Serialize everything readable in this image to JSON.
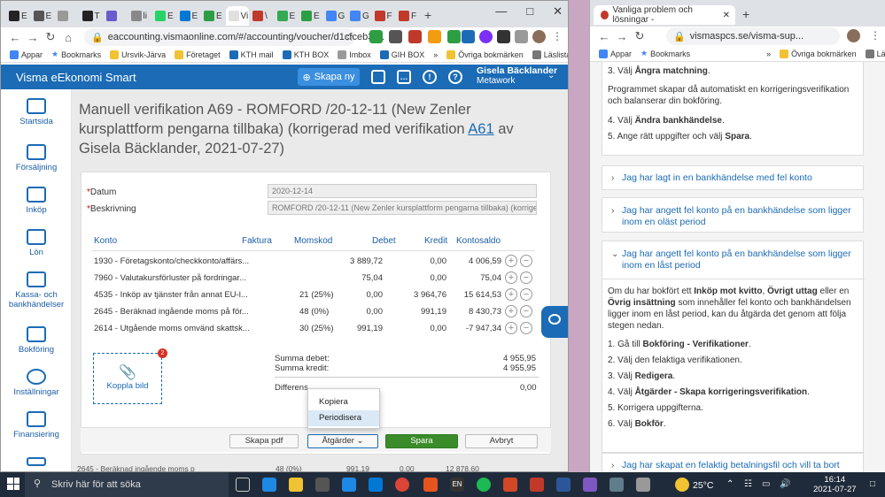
{
  "browser_left": {
    "tabs": [
      {
        "label": "E",
        "color": "#222"
      },
      {
        "label": "E",
        "color": "#555"
      },
      {
        "label": "",
        "color": "#999"
      },
      {
        "label": "T",
        "color": "#222"
      },
      {
        "label": "",
        "color": "#6a5acd"
      },
      {
        "label": "li",
        "color": "#888"
      },
      {
        "label": "E",
        "color": "#25d366"
      },
      {
        "label": "E",
        "color": "#0078d4"
      },
      {
        "label": "E",
        "color": "#2e9e44"
      },
      {
        "label": "Vi",
        "color": "#e0e0e0"
      },
      {
        "label": "\\",
        "color": "#c0392b"
      },
      {
        "label": "E",
        "color": "#34a853"
      },
      {
        "label": "E",
        "color": "#2e9e44"
      },
      {
        "label": "G",
        "color": "#4285f4"
      },
      {
        "label": "G",
        "color": "#4285f4"
      },
      {
        "label": "F",
        "color": "#c0392b"
      },
      {
        "label": "F",
        "color": "#c0392b"
      }
    ],
    "new_tab": "+",
    "url": "eaccounting.vismaonline.com/#/accounting/voucher/d1cfceb3-...",
    "bookmarks": [
      "Appar",
      "Bookmarks",
      "Ursvik-Järva",
      "Företaget",
      "KTH mail",
      "KTH BOX",
      "Imbox",
      "GIH BOX"
    ],
    "bookmarks_more": "»",
    "other_bookmarks": "Övriga bokmärken",
    "reading_list": "Läslista"
  },
  "app": {
    "name": "Visma eEkonomi Smart",
    "create_button": "Skapa ny",
    "user_name": "Gisela Bäcklander",
    "company": "Metawork",
    "sidebar": [
      "Startsida",
      "Försäljning",
      "Inköp",
      "Lön",
      "Kassa- och bankhändelser",
      "Bokföring",
      "Inställningar",
      "Finansiering"
    ]
  },
  "voucher": {
    "title_prefix": "Manuell verifikation A69  -  ROMFORD /20-12-11 (New Zenler kursplattform pengarna tillbaka) (korrigerad med verifikation ",
    "title_link": "A61",
    "title_suffix": " av Gisela Bäcklander, 2021-07-27)",
    "date_label": "Datum",
    "date_value": "2020-12-14",
    "description_label": "Beskrivning",
    "description_value": "ROMFORD /20-12-11 (New Zenler kursplattform pengarna tillbaka) (korriger",
    "columns": [
      "Konto",
      "Faktura",
      "Momskod",
      "Debet",
      "Kredit",
      "Kontosaldo"
    ],
    "rows": [
      {
        "konto": "1930 - Företagskonto/checkkonto/affärs...",
        "momskod": "",
        "debet": "3 889,72",
        "kredit": "0,00",
        "saldo": "4 006,59"
      },
      {
        "konto": "7960 - Valutakursförluster på fordringar...",
        "momskod": "",
        "debet": "75,04",
        "kredit": "0,00",
        "saldo": "75,04"
      },
      {
        "konto": "4535 - Inköp av tjänster från annat EU-l...",
        "momskod": "21 (25%)",
        "debet": "0,00",
        "kredit": "3 964,76",
        "saldo": "15 614,53"
      },
      {
        "konto": "2645 - Beräknad ingående moms på för...",
        "momskod": "48 (0%)",
        "debet": "0,00",
        "kredit": "991,19",
        "saldo": "8 430,73"
      },
      {
        "konto": "2614 - Utgående moms omvänd skattsk...",
        "momskod": "30 (25%)",
        "debet": "991,19",
        "kredit": "0,00",
        "saldo": "-7 947,34"
      }
    ],
    "attach_label": "Koppla bild",
    "attach_count": "2",
    "sum_debet_label": "Summa debet:",
    "sum_debet": "4 955,95",
    "sum_kredit_label": "Summa kredit:",
    "sum_kredit": "4 955,95",
    "diff_label": "Differens",
    "diff_value": "0,00",
    "dropdown": [
      "Kopiera",
      "Periodisera"
    ],
    "btn_pdf": "Skapa pdf",
    "btn_actions": "Åtgärder",
    "btn_save": "Spara",
    "btn_cancel": "Avbryt",
    "peek_row": {
      "konto": "2645 - Beräknad ingående moms p",
      "momskod": "48 (0%)",
      "debet": "991,19",
      "kredit": "0,00",
      "saldo": "12 878,60"
    }
  },
  "browser_right": {
    "tab_title": "Vanliga problem och lösningar -",
    "url": "vismaspcs.se/visma-sup...",
    "bookmarks": [
      "Appar",
      "Bookmarks"
    ],
    "bookmarks_more": "»",
    "other_bookmarks": "Övriga bokmärken",
    "reading_list": "Läslista",
    "top_steps": {
      "step3_prefix": "3. Välj ",
      "step3_bold": "Ångra matchning",
      "step3_suffix": ".",
      "para": "Programmet skapar då automatiskt en korrigeringsverifikation och balanserar din bokföring.",
      "step4_prefix": "4. Välj ",
      "step4_bold": "Ändra bankhändelse",
      "step4_suffix": ".",
      "step5_prefix": "5. Ange rätt uppgifter och välj ",
      "step5_bold": "Spara",
      "step5_suffix": "."
    },
    "faq1": "Jag har lagt in en bankhändelse med fel konto",
    "faq2": "Jag har angett fel konto på en bankhändelse som ligger inom en oläst period",
    "faq3": "Jag har angett fel konto på en bankhändelse som ligger inom en låst period",
    "faq3_intro_1": "Om du har bokfört ett ",
    "faq3_b1": "Inköp mot kvitto",
    "faq3_intro_2": ", ",
    "faq3_b2": "Övrigt uttag",
    "faq3_intro_3": " eller en ",
    "faq3_b3": "Övrig insättning",
    "faq3_intro_4": " som innehåller fel konto och bankhändelsen ligger inom en låst period, kan du åtgärda det genom att följa stegen nedan.",
    "steps": [
      {
        "prefix": "1. Gå till ",
        "bold": "Bokföring - Verifikationer",
        "suffix": "."
      },
      {
        "prefix": "2. Välj den felaktiga verifikationen.",
        "bold": "",
        "suffix": ""
      },
      {
        "prefix": "3. Välj ",
        "bold": "Redigera",
        "suffix": "."
      },
      {
        "prefix": "4. Välj ",
        "bold": "Åtgärder - Skapa korrigeringsverifikation",
        "suffix": "."
      },
      {
        "prefix": "5. Korrigera uppgifterna.",
        "bold": "",
        "suffix": ""
      },
      {
        "prefix": "6. Välj ",
        "bold": "Bokför",
        "suffix": "."
      }
    ],
    "faq4": "Jag har skapat en felaktig betalningsfil och vill ta bort den"
  },
  "taskbar": {
    "search_placeholder": "Skriv här för att söka",
    "weather": "25°C",
    "lang": "EN",
    "time": "16:14",
    "date": "2021-07-27"
  },
  "colors": {
    "brand_blue": "#1b6bb6",
    "save_green": "#3a8c2a",
    "link_blue": "#1b6bb6"
  }
}
